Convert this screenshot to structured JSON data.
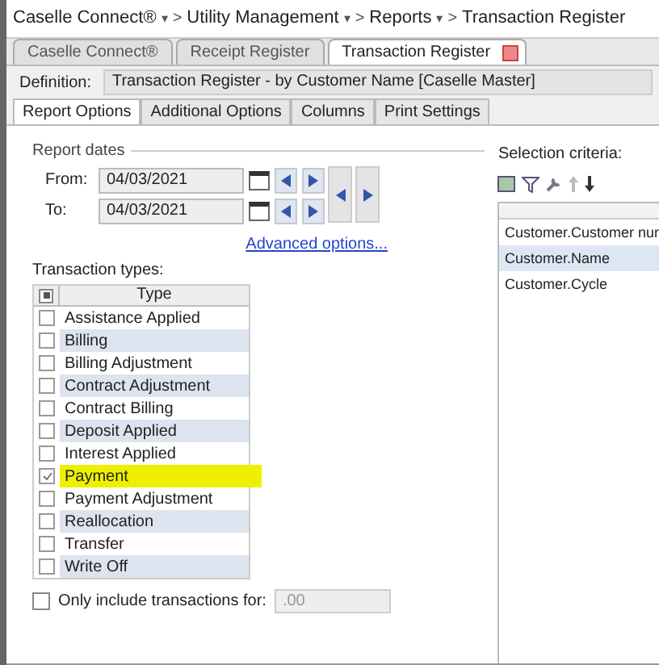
{
  "breadcrumb": [
    {
      "label": "Caselle Connect®"
    },
    {
      "label": "Utility Management"
    },
    {
      "label": "Reports"
    },
    {
      "label": "Transaction Register"
    }
  ],
  "separator": {
    "caret": "▾",
    "arrow": ">"
  },
  "doc_tabs": [
    {
      "label": "Caselle Connect®",
      "selected": false,
      "closable": false
    },
    {
      "label": "Receipt Register",
      "selected": false,
      "closable": false
    },
    {
      "label": "Transaction Register",
      "selected": true,
      "closable": true
    }
  ],
  "definition": {
    "label": "Definition:",
    "value": "Transaction Register - by Customer Name [Caselle Master]"
  },
  "option_tabs": [
    {
      "label": "Report Options",
      "selected": true
    },
    {
      "label": "Additional Options",
      "selected": false
    },
    {
      "label": "Columns",
      "selected": false
    },
    {
      "label": "Print Settings",
      "selected": false
    }
  ],
  "report_dates": {
    "title": "Report dates",
    "from_label": "From:",
    "from_value": "04/03/2021",
    "to_label": "To:",
    "to_value": "04/03/2021",
    "advanced_link": "Advanced options..."
  },
  "transaction_types": {
    "title": "Transaction types:",
    "header": "Type",
    "select_all_indeterminate": true,
    "rows": [
      {
        "label": "Assistance Applied",
        "checked": false,
        "highlighted": false
      },
      {
        "label": "Billing",
        "checked": false,
        "highlighted": false
      },
      {
        "label": "Billing Adjustment",
        "checked": false,
        "highlighted": false
      },
      {
        "label": "Contract Adjustment",
        "checked": false,
        "highlighted": false
      },
      {
        "label": "Contract Billing",
        "checked": false,
        "highlighted": false
      },
      {
        "label": "Deposit Applied",
        "checked": false,
        "highlighted": false
      },
      {
        "label": "Interest Applied",
        "checked": false,
        "highlighted": false
      },
      {
        "label": "Payment",
        "checked": true,
        "highlighted": true
      },
      {
        "label": "Payment Adjustment",
        "checked": false,
        "highlighted": false
      },
      {
        "label": "Reallocation",
        "checked": false,
        "highlighted": false
      },
      {
        "label": "Transfer",
        "checked": false,
        "highlighted": false
      },
      {
        "label": "Write Off",
        "checked": false,
        "highlighted": false
      }
    ]
  },
  "only_include": {
    "label": "Only include transactions for:",
    "checked": false,
    "placeholder": ".00"
  },
  "selection_criteria": {
    "title": "Selection criteria:",
    "rows": [
      {
        "label": "Customer.Customer nur",
        "selected": false
      },
      {
        "label": "Customer.Name",
        "selected": true
      },
      {
        "label": "Customer.Cycle",
        "selected": false
      }
    ]
  }
}
